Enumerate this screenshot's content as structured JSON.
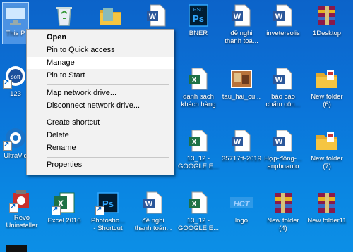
{
  "context_menu": {
    "items": [
      {
        "label": "Open",
        "bold": true
      },
      {
        "label": "Pin to Quick access"
      },
      {
        "label": "Manage",
        "highlighted": true
      },
      {
        "label": "Pin to Start"
      },
      {
        "label": "Map network drive..."
      },
      {
        "label": "Disconnect network drive..."
      },
      {
        "label": "Create shortcut"
      },
      {
        "label": "Delete"
      },
      {
        "label": "Rename"
      },
      {
        "label": "Properties"
      }
    ]
  },
  "desktop": {
    "icons": [
      {
        "id": "this-pc",
        "label": "This P",
        "type": "pc",
        "selected": true
      },
      {
        "id": "recycle-bin",
        "label": "",
        "type": "bin"
      },
      {
        "id": "folder-top",
        "label": "",
        "type": "folder"
      },
      {
        "id": "word-top",
        "label": "",
        "type": "word"
      },
      {
        "id": "bner",
        "label": "BNER",
        "type": "psd",
        "badge": "PSD"
      },
      {
        "id": "de-nghi-1",
        "label": "đề nghi\nthanh toá...",
        "type": "word"
      },
      {
        "id": "invetersolis",
        "label": "invetersolis",
        "type": "word"
      },
      {
        "id": "1desktop",
        "label": "1Desktop",
        "type": "rar"
      },
      {
        "id": "app-123",
        "label": "123",
        "type": "app",
        "shortcut": true
      },
      {
        "id": "danh-sach",
        "label": "danh sách\nkhách hàng",
        "type": "excel"
      },
      {
        "id": "tau-hai-cu",
        "label": "tau_hai_cu...",
        "type": "photo"
      },
      {
        "id": "bao-cao",
        "label": "báo cáo\nchấm côn...",
        "type": "word"
      },
      {
        "id": "new-folder-6",
        "label": "New folder\n(6)",
        "type": "folder"
      },
      {
        "id": "ultraviewer",
        "label": "UltraVie",
        "type": "ultraviewer",
        "shortcut": true
      },
      {
        "id": "13-12-google-1",
        "label": "13_12 -\nGOOGLE E...",
        "type": "excel"
      },
      {
        "id": "35717",
        "label": "35717tt-2019",
        "type": "word"
      },
      {
        "id": "hop-dong",
        "label": "Hợp-đồng-...\nanphuauto",
        "type": "word"
      },
      {
        "id": "new-folder-7",
        "label": "New folder\n(7)",
        "type": "folder"
      },
      {
        "id": "revo",
        "label": "Revo\nUninstaller",
        "type": "revo",
        "shortcut": true
      },
      {
        "id": "excel-2016",
        "label": "Excel 2016",
        "type": "excel",
        "shortcut": true
      },
      {
        "id": "photoshop",
        "label": "Photosho...\n- Shortcut",
        "type": "psd",
        "badge": "Ps",
        "shortcut": true
      },
      {
        "id": "de-nghi-2",
        "label": "đề nghi\nthanh toán...",
        "type": "word"
      },
      {
        "id": "13-12-google-2",
        "label": "13_12 -\nGOOGLE E...",
        "type": "excel"
      },
      {
        "id": "logo",
        "label": "logo",
        "type": "hct",
        "badge": "HCT"
      },
      {
        "id": "new-folder-4",
        "label": "New folder\n(4)",
        "type": "rar"
      },
      {
        "id": "new-folder-11",
        "label": "New folder11",
        "type": "rar"
      }
    ]
  },
  "colors": {
    "desktop_blue": "#0b6fd4",
    "word_blue": "#2b579a",
    "excel_green": "#1e7145",
    "ps_navy": "#001d34",
    "ps_blue": "#31a8ff",
    "rar_red": "#8b1a4a",
    "folder_yellow": "#f5c542"
  }
}
